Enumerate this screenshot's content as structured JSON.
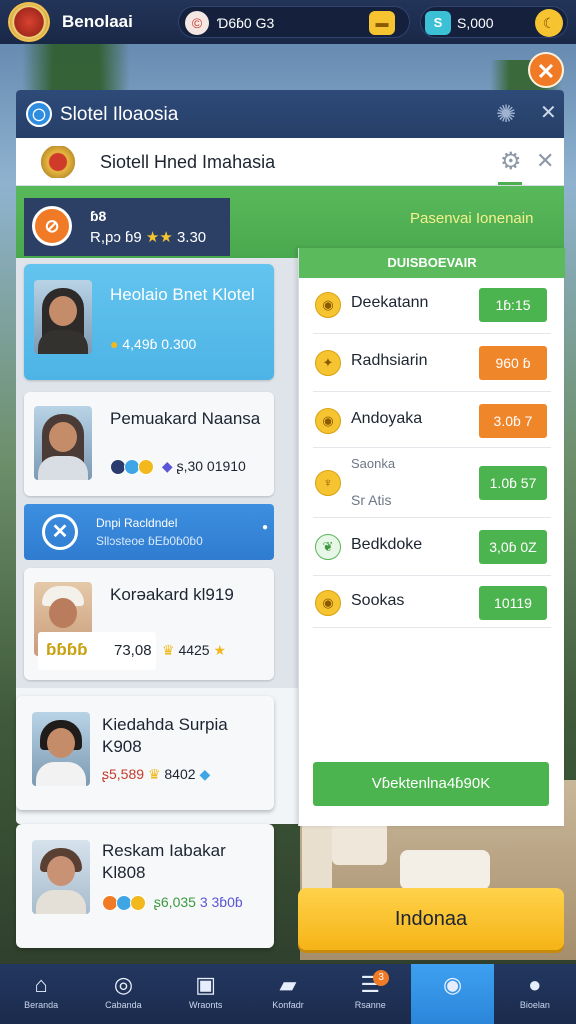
{
  "topbar": {
    "brand": "Benolaai",
    "currency1": "Ɗ6ɓ0 G3",
    "currency2": "S,000",
    "colors": {
      "bar": "#1a2847",
      "gold": "#f6c431",
      "teal": "#3cc0d6"
    }
  },
  "panel": {
    "title": "Slotel Iloaosia",
    "subtitle": "Siotell Hned Imahasia"
  },
  "player": {
    "name": "ɓ8",
    "stats_prefix": "R,pɔ ɓ9",
    "stars": "★★",
    "stats_value": "3.30"
  },
  "greenbar_label": "Pasenvai Ionenain",
  "left_cards": [
    {
      "name": "Heolaio Bnet Klotel",
      "stat": "4,49ɓ 0.300"
    },
    {
      "name": "Pemuakard Naansa",
      "stat": "ʂ,30 01910"
    },
    {
      "name": "Korəakard kl919",
      "chip": "ɓɓɓɓ",
      "stat": "73,08",
      "stat2": "4425"
    }
  ],
  "blue_banner": {
    "line1": "Dnpi Racldndel",
    "line2": "Sllɔsteoe ɓEɓ0ɓ0ɓ0"
  },
  "right_panel": {
    "header": "DUISBOEVAIR",
    "rows": [
      {
        "label": "Deekatann",
        "value": "1ɓ:15",
        "color": "green"
      },
      {
        "label": "Radhsiarin",
        "value": "960 ɓ",
        "color": "orange"
      },
      {
        "label": "Andoyaka",
        "value": "3.0ɓ 7",
        "color": "orange"
      },
      {
        "label": "Sr Atis",
        "sublabel": "Saonka",
        "value": "1.0ɓ 57",
        "color": "green"
      },
      {
        "label": "Bedkdoke",
        "value": "3,0ɓ 0Z",
        "color": "green"
      },
      {
        "label": "Sookas",
        "value": "10119",
        "color": "green"
      }
    ],
    "button": "Vɓektenlna4ɓ90K"
  },
  "outer_cards": [
    {
      "name": "Kiedahda Surpia K908",
      "stat": "ʂ5,589",
      "stat2": "8402"
    },
    {
      "name": "Reskam Iabakar Kl808",
      "stat": "ʂ6,035",
      "stat2": "3 3ɓ0ɓ"
    }
  ],
  "cta": "Indonaa",
  "nav": [
    {
      "icon": "home-icon",
      "label": "Beranda"
    },
    {
      "icon": "search-icon",
      "label": "Cabanda"
    },
    {
      "icon": "calendar-icon",
      "label": "Wraonts"
    },
    {
      "icon": "folder-icon",
      "label": "Konfadr"
    },
    {
      "icon": "list-icon",
      "label": "Rsanne",
      "badge": "3"
    },
    {
      "icon": "shield-icon",
      "label": ""
    },
    {
      "icon": "drop-icon",
      "label": "Bioelan"
    }
  ]
}
